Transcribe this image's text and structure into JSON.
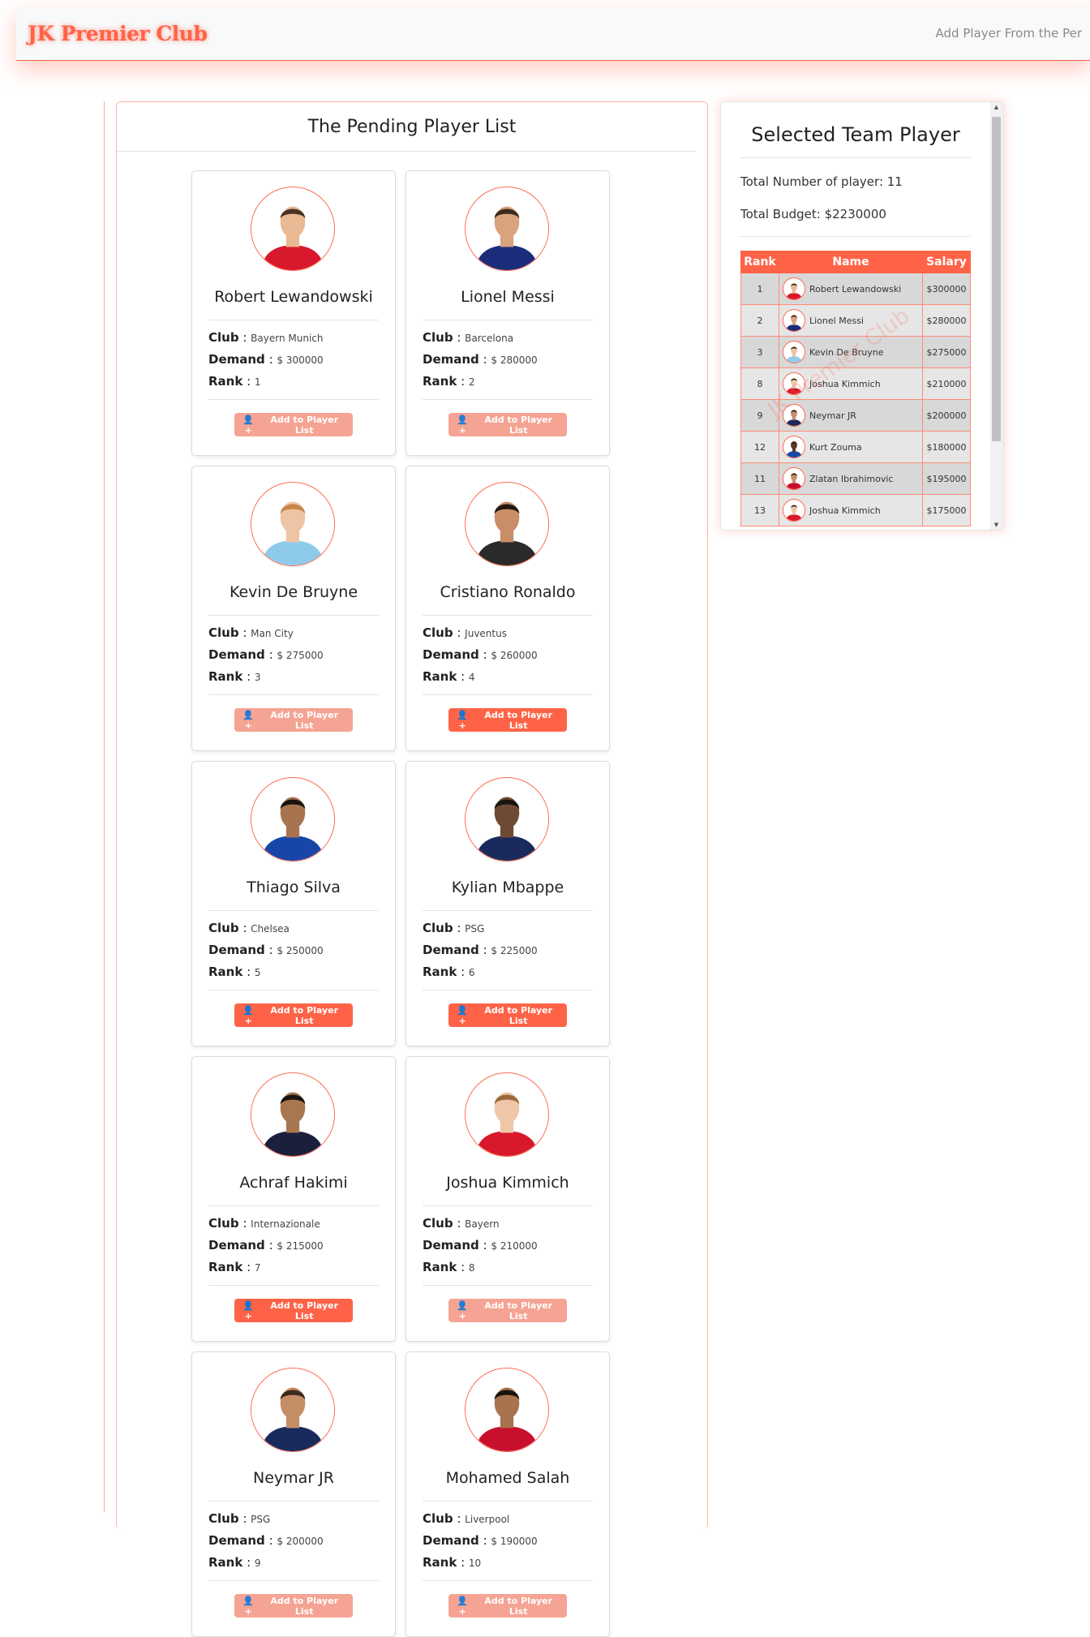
{
  "navbar": {
    "brand": "JK Premier Club",
    "link": "Add Player From the Per"
  },
  "pending": {
    "title": "The Pending Player List",
    "players": [
      {
        "name": "Robert Lewandowski",
        "club": "Bayern Munich",
        "demand": "$ 300000",
        "rank": "1",
        "added": true,
        "jersey": "#d8182b",
        "skin": "#e9b994",
        "hair": "#4a3322"
      },
      {
        "name": "Lionel Messi",
        "club": "Barcelona",
        "demand": "$ 280000",
        "rank": "2",
        "added": true,
        "jersey": "#1b2c7a",
        "skin": "#d9a37e",
        "hair": "#3c2a1e"
      },
      {
        "name": "Kevin De Bruyne",
        "club": "Man City",
        "demand": "$ 275000",
        "rank": "3",
        "added": true,
        "jersey": "#8ecbea",
        "skin": "#efc4a5",
        "hair": "#c6864a"
      },
      {
        "name": "Cristiano Ronaldo",
        "club": "Juventus",
        "demand": "$ 260000",
        "rank": "4",
        "added": false,
        "jersey": "#2a2a2a",
        "skin": "#c98e68",
        "hair": "#1f1712"
      },
      {
        "name": "Thiago Silva",
        "club": "Chelsea",
        "demand": "$ 250000",
        "rank": "5",
        "added": false,
        "jersey": "#1746a8",
        "skin": "#a8744f",
        "hair": "#1a1410"
      },
      {
        "name": "Kylian Mbappe",
        "club": "PSG",
        "demand": "$ 225000",
        "rank": "6",
        "added": false,
        "jersey": "#1b2a5c",
        "skin": "#6e4a35",
        "hair": "#1a1410"
      },
      {
        "name": "Achraf Hakimi",
        "club": "Internazionale",
        "demand": "$ 215000",
        "rank": "7",
        "added": false,
        "jersey": "#1a1f3c",
        "skin": "#a8774f",
        "hair": "#1a1410"
      },
      {
        "name": "Joshua Kimmich",
        "club": "Bayern",
        "demand": "$ 210000",
        "rank": "8",
        "added": true,
        "jersey": "#d8182b",
        "skin": "#f0c6a8",
        "hair": "#9b6a3c"
      },
      {
        "name": "Neymar JR",
        "club": "PSG",
        "demand": "$ 200000",
        "rank": "9",
        "added": true,
        "jersey": "#1b2a5c",
        "skin": "#c48e67",
        "hair": "#3a2a1c"
      },
      {
        "name": "Mohamed Salah",
        "club": "Liverpool",
        "demand": "$ 190000",
        "rank": "10",
        "added": true,
        "jersey": "#c8102e",
        "skin": "#a8744f",
        "hair": "#1a1410"
      }
    ],
    "labels": {
      "club": "Club",
      "demand": "Demand",
      "rank": "Rank",
      "button": "Add to Player List",
      "sep": " : "
    }
  },
  "selected": {
    "title": "Selected Team Player",
    "total_players": "Total Number of player: 11",
    "total_budget": "Total Budget: $2230000",
    "columns": [
      "Rank",
      "Name",
      "Salary"
    ],
    "rows": [
      {
        "rank": "1",
        "name": "Robert Lewandowski",
        "salary": "$300000",
        "jersey": "#d8182b",
        "skin": "#e9b994"
      },
      {
        "rank": "2",
        "name": "Lionel Messi",
        "salary": "$280000",
        "jersey": "#1b2c7a",
        "skin": "#d9a37e"
      },
      {
        "rank": "3",
        "name": "Kevin De Bruyne",
        "salary": "$275000",
        "jersey": "#8ecbea",
        "skin": "#efc4a5"
      },
      {
        "rank": "8",
        "name": "Joshua Kimmich",
        "salary": "$210000",
        "jersey": "#d8182b",
        "skin": "#f0c6a8"
      },
      {
        "rank": "9",
        "name": "Neymar JR",
        "salary": "$200000",
        "jersey": "#1b2a5c",
        "skin": "#c48e67"
      },
      {
        "rank": "12",
        "name": "Kurt Zouma",
        "salary": "$180000",
        "jersey": "#1746a8",
        "skin": "#5a3b28"
      },
      {
        "rank": "11",
        "name": "Zlatan Ibrahimovic",
        "salary": "$195000",
        "jersey": "#c8102e",
        "skin": "#c98e68"
      },
      {
        "rank": "13",
        "name": "Joshua Kimmich",
        "salary": "$175000",
        "jersey": "#d8182b",
        "skin": "#f0c6a8"
      }
    ],
    "watermark": "JK Premier Club"
  },
  "colors": {
    "accent": "#ff6347",
    "accent_light": "#f59f8e"
  }
}
